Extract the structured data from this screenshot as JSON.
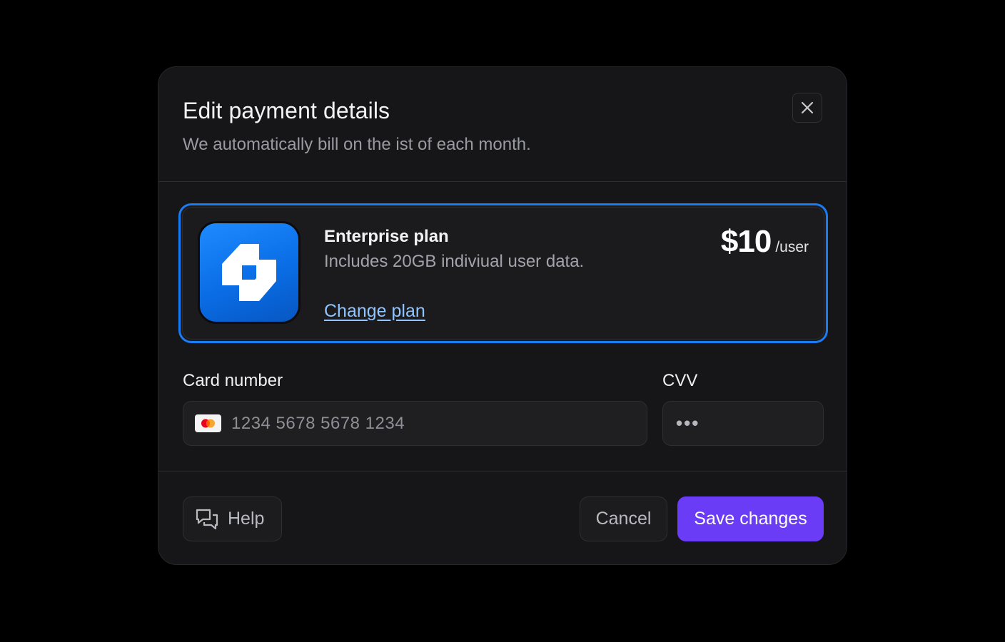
{
  "dialog": {
    "title": "Edit payment details",
    "subtitle": "We automatically bill on the ist of each month."
  },
  "plan": {
    "name": "Enterprise plan",
    "description": "Includes 20GB indiviual user data.",
    "change_link": "Change plan",
    "price": "$10",
    "price_unit": "/user",
    "accent_color": "#1a7cf4"
  },
  "form": {
    "card_number_label": "Card number",
    "card_number_value": "1234 5678 5678 1234",
    "card_brand_icon": "mastercard-icon",
    "cvv_label": "CVV",
    "cvv_value": "•••"
  },
  "footer": {
    "help_label": "Help",
    "cancel_label": "Cancel",
    "save_label": "Save changes",
    "save_color": "#6b3cf5"
  }
}
